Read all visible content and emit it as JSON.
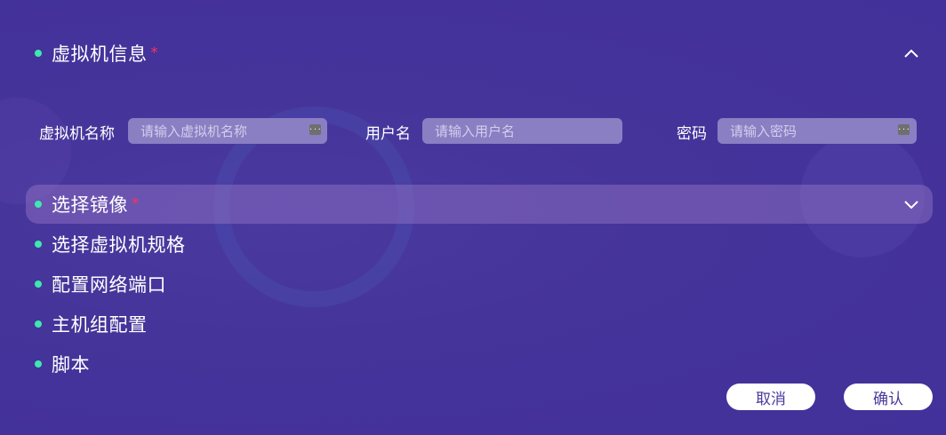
{
  "sections": [
    {
      "title": "虚拟机信息",
      "required": "*"
    },
    {
      "title": "选择镜像",
      "required": "*"
    },
    {
      "title": "选择虚拟机规格"
    },
    {
      "title": "配置网络端口"
    },
    {
      "title": "主机组配置"
    },
    {
      "title": "脚本"
    }
  ],
  "form": {
    "vm_name": {
      "label": "虚拟机名称",
      "placeholder": "请输入虚拟机名称",
      "value": ""
    },
    "username": {
      "label": "用户名",
      "placeholder": "请输入用户名",
      "value": ""
    },
    "password": {
      "label": "密码",
      "placeholder": "请输入密码",
      "value": ""
    }
  },
  "buttons": {
    "cancel": "取消",
    "confirm": "确认"
  },
  "colors": {
    "background": "#45349a",
    "bullet": "#3ee8b0",
    "required": "#ff3355",
    "input_bg": "#8a7fc2",
    "button_text": "#4b3a9e"
  },
  "icons": {
    "collapse": "chevron-up-icon",
    "expand": "chevron-down-icon",
    "password_manager": "key-dots-icon"
  }
}
